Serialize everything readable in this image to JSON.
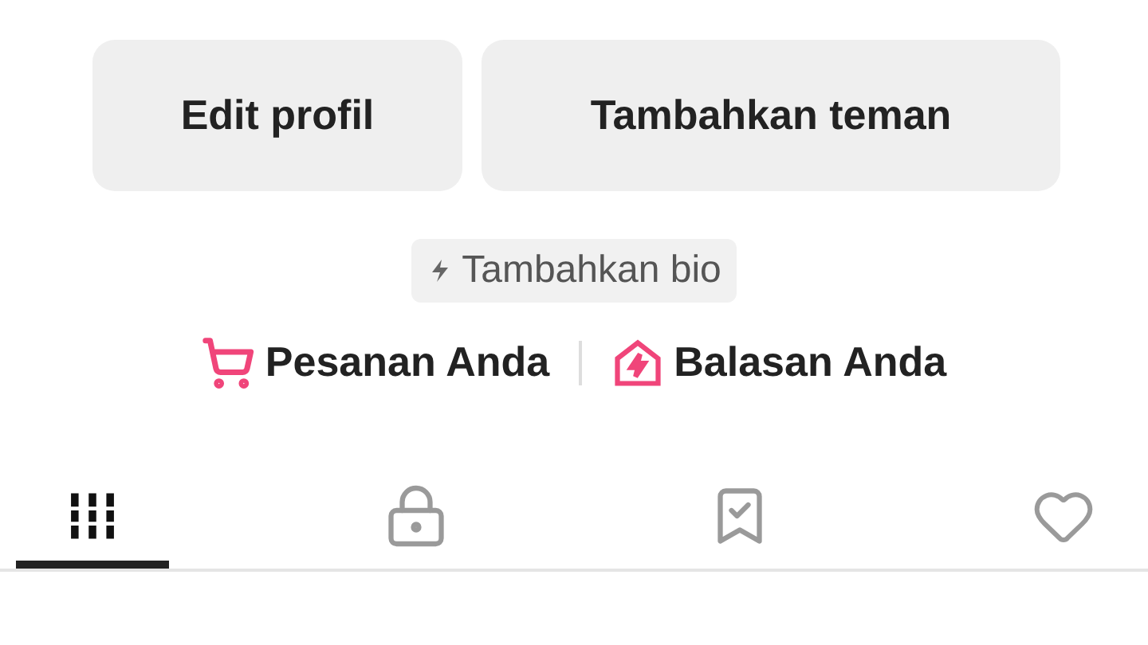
{
  "buttons": [
    {
      "label": "Edit profil"
    },
    {
      "label": "Tambahkan teman"
    }
  ],
  "bio_button": {
    "label": "Tambahkan bio"
  },
  "links": [
    {
      "label": "Pesanan Anda",
      "kind": "cart"
    },
    {
      "label": "Balasan Anda",
      "kind": "reply"
    }
  ],
  "tabs": [
    {
      "kind": "grid",
      "selected": true
    },
    {
      "kind": "lock",
      "selected": false
    },
    {
      "kind": "bookmark",
      "selected": false
    },
    {
      "kind": "heart",
      "selected": false
    }
  ]
}
